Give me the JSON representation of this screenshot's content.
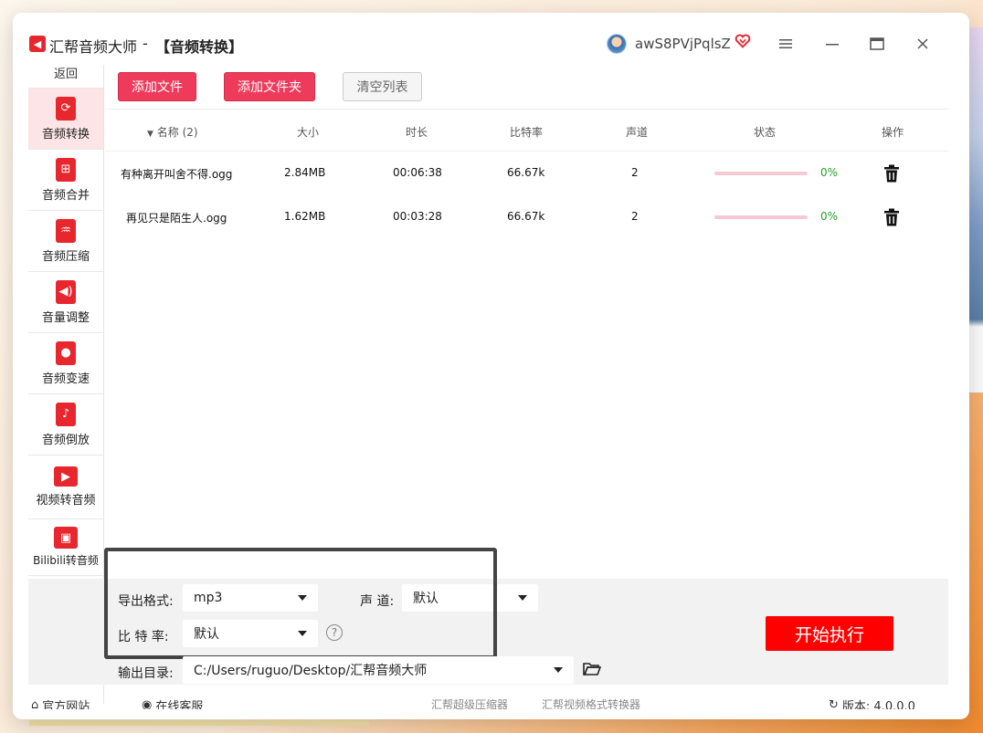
{
  "window": {
    "app_name": "汇帮音频大师",
    "separator": "-",
    "page_title": "【音频转换】",
    "username": "awS8PVjPqlsZ"
  },
  "sidebar": {
    "back_label": "返回",
    "items": [
      {
        "label": "音频转换",
        "icon": "audio-convert-icon",
        "active": true
      },
      {
        "label": "音频合并",
        "icon": "audio-merge-icon",
        "active": false
      },
      {
        "label": "音频压缩",
        "icon": "audio-compress-icon",
        "active": false
      },
      {
        "label": "音量调整",
        "icon": "volume-adjust-icon",
        "active": false
      },
      {
        "label": "音频变速",
        "icon": "audio-speed-icon",
        "active": false
      },
      {
        "label": "音频倒放",
        "icon": "audio-reverse-icon",
        "active": false
      },
      {
        "label": "视频转音频",
        "icon": "video-to-audio-icon",
        "active": false
      },
      {
        "label": "Bilibili转音频",
        "icon": "bilibili-icon",
        "active": false
      }
    ]
  },
  "toolbar": {
    "add_file": "添加文件",
    "add_folder": "添加文件夹",
    "clear_list": "清空列表"
  },
  "table": {
    "headers": {
      "name": "名称 (2)",
      "size": "大小",
      "duration": "时长",
      "bitrate": "比特率",
      "channel": "声道",
      "status": "状态",
      "action": "操作"
    },
    "rows": [
      {
        "name": "有种离开叫舍不得.ogg",
        "size": "2.84MB",
        "duration": "00:06:38",
        "bitrate": "66.67k",
        "channel": "2",
        "progress": 0,
        "progress_text": "0%"
      },
      {
        "name": "再见只是陌生人.ogg",
        "size": "1.62MB",
        "duration": "00:03:28",
        "bitrate": "66.67k",
        "channel": "2",
        "progress": 0,
        "progress_text": "0%"
      }
    ]
  },
  "settings": {
    "format_label": "导出格式:",
    "format_value": "mp3",
    "channel_label": "声 道:",
    "channel_value": "默认",
    "bitrate_label": "比 特 率:",
    "bitrate_value": "默认",
    "help_glyph": "?",
    "output_label": "输出目录:",
    "output_path": "C:/Users/ruguo/Desktop/汇帮音频大师",
    "start_button": "开始执行"
  },
  "footer": {
    "official_site": "官方网站",
    "online_service": "在线客服",
    "promo_1": "汇帮超级压缩器",
    "promo_2": "汇帮视频格式转换器",
    "version": "版本: 4.0.0.0"
  },
  "colors": {
    "accent": "#ee3b5c",
    "start_button": "#ff0000",
    "sidebar_icon": "#e8262e",
    "progress_text": "#2aa02a"
  }
}
